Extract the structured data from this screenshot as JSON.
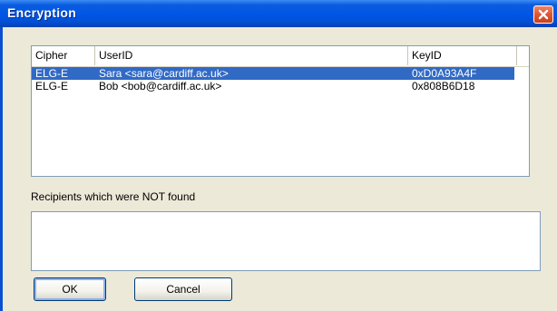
{
  "window": {
    "title": "Encryption"
  },
  "list": {
    "columns": [
      "Cipher",
      "UserID",
      "KeyID"
    ],
    "rows": [
      {
        "cipher": "ELG-E",
        "userid": "Sara <sara@cardiff.ac.uk>",
        "keyid": "0xD0A93A4F",
        "selected": true
      },
      {
        "cipher": "ELG-E",
        "userid": "Bob <bob@cardiff.ac.uk>",
        "keyid": "0x808B6D18",
        "selected": false
      }
    ]
  },
  "notfound": {
    "label": "Recipients which were NOT found"
  },
  "buttons": {
    "ok": "OK",
    "cancel": "Cancel"
  },
  "colors": {
    "titlebar": "#0055e5",
    "selection": "#316ac5",
    "close": "#e05a36",
    "dialog_bg": "#ece9d8"
  },
  "icons": {
    "close": "close-icon"
  }
}
